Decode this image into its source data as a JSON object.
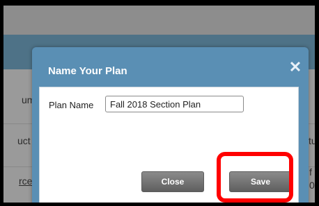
{
  "background": {
    "col1_text_1": "um",
    "col1_text_2": "uct",
    "col1_link": "rce",
    "col2_text_1": "tu",
    "col2_text_2": "f 4",
    "col2_text_3": "0 c"
  },
  "dialog": {
    "title": "Name Your Plan",
    "close_icon": "✕",
    "field_label": "Plan Name",
    "field_value": "Fall 2018 Section Plan",
    "close_button": "Close",
    "save_button": "Save"
  },
  "colors": {
    "dialog_header": "#5a8fb4",
    "button": "#6d6d6d",
    "highlight": "#ff0000"
  }
}
